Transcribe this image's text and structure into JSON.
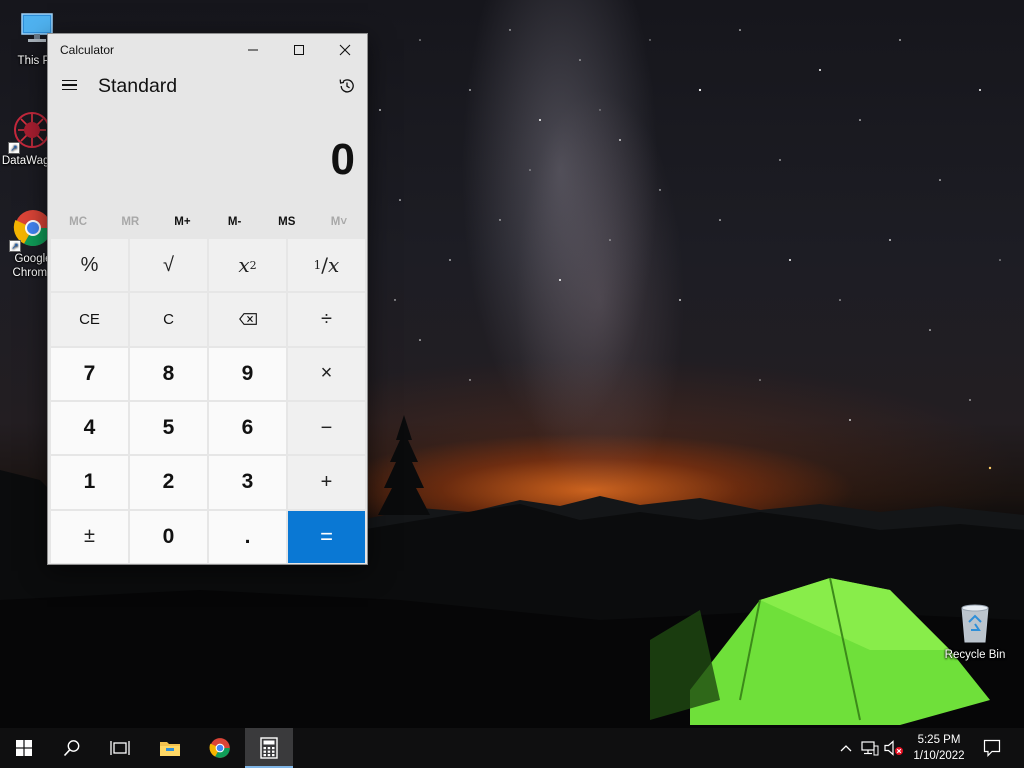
{
  "desktop": {
    "icons": [
      {
        "label": "This PC",
        "icon": "computer-icon"
      },
      {
        "label": "DataWagon",
        "icon": "datawagon-app-icon"
      },
      {
        "label": "Google\nChrome",
        "icon": "chrome-icon"
      },
      {
        "label": "Recycle Bin",
        "icon": "recycle-bin-icon"
      }
    ]
  },
  "calculator": {
    "window_title": "Calculator",
    "window_controls": {
      "minimize": "minimize-icon",
      "maximize": "maximize-icon",
      "close": "close-icon"
    },
    "mode": "Standard",
    "display_value": "0",
    "memory_buttons": [
      {
        "label": "MC",
        "enabled": false
      },
      {
        "label": "MR",
        "enabled": false
      },
      {
        "label": "M+",
        "enabled": true
      },
      {
        "label": "M-",
        "enabled": true
      },
      {
        "label": "MS",
        "enabled": true
      },
      {
        "label": "M˅",
        "enabled": false
      }
    ],
    "keys": {
      "percent": "%",
      "sqrt": "√",
      "square_base": "x",
      "square_exp": "2",
      "reciprocal_num": "1",
      "reciprocal_den": "x",
      "clear_entry": "CE",
      "clear": "C",
      "divide": "÷",
      "seven": "7",
      "eight": "8",
      "nine": "9",
      "multiply": "×",
      "four": "4",
      "five": "5",
      "six": "6",
      "subtract": "−",
      "one": "1",
      "two": "2",
      "three": "3",
      "add": "+",
      "negate": "±",
      "zero": "0",
      "decimal": ".",
      "equals": "="
    },
    "accent_color": "#0a78d4"
  },
  "taskbar": {
    "pinned": [
      "start-icon",
      "search-icon",
      "task-view-icon",
      "file-explorer-icon",
      "chrome-icon",
      "calculator-icon"
    ],
    "active": "calculator-icon",
    "tray": [
      "chevron-up-icon",
      "network-icon",
      "volume-muted-icon",
      "notification-icon"
    ],
    "clock": {
      "time": "5:25 PM",
      "date": "1/10/2022"
    }
  }
}
